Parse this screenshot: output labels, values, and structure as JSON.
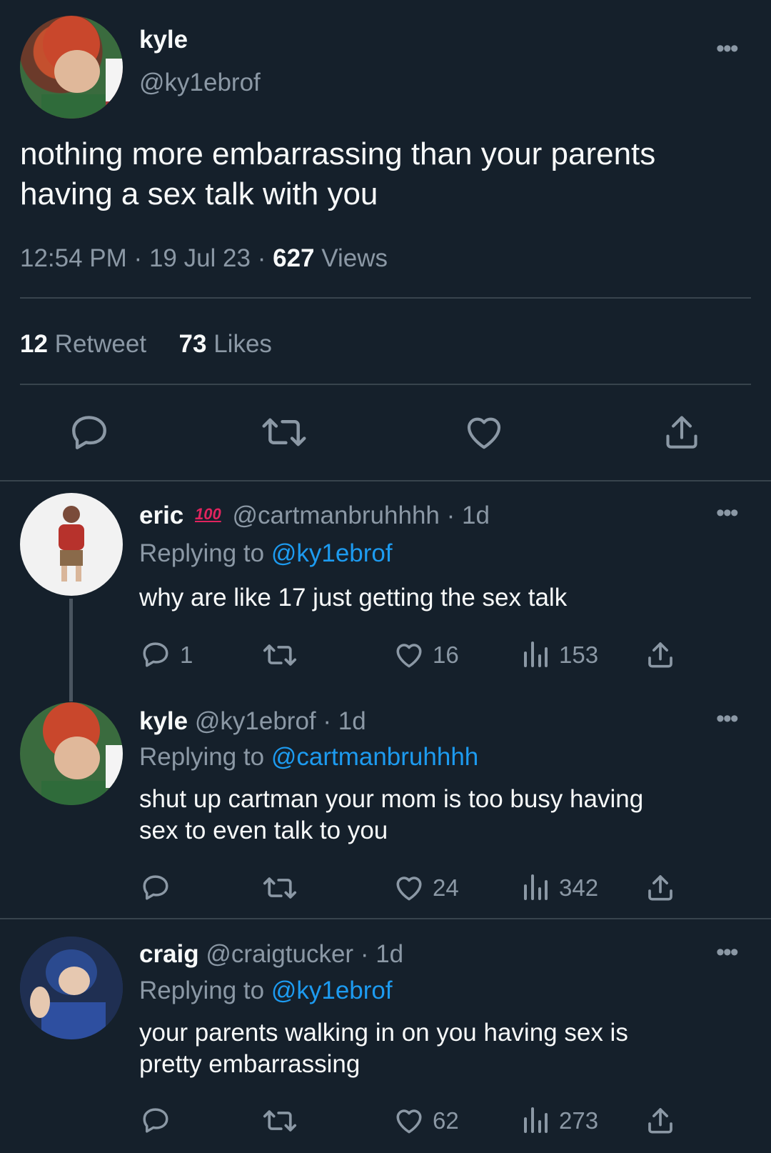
{
  "main_tweet": {
    "name": "kyle",
    "handle": "@ky1ebrof",
    "text_line1": "nothing more embarrassing than your parents",
    "text_line2": "having a sex talk with you",
    "time": "12:54 PM",
    "date": "19 Jul 23",
    "views_count": "627",
    "views_label": "Views",
    "retweet_count": "12",
    "retweet_label": "Retweet",
    "likes_count": "73",
    "likes_label": "Likes"
  },
  "replies": [
    {
      "name": "eric",
      "badge": "100",
      "handle": "@cartmanbruhhhh",
      "age": "1d",
      "replying_label": "Replying to",
      "replying_to": "@ky1ebrof",
      "text_line1": "why are like 17 just getting the sex talk",
      "text_line2": "",
      "reply_count": "1",
      "like_count": "16",
      "view_count": "153"
    },
    {
      "name": "kyle",
      "handle": "@ky1ebrof",
      "age": "1d",
      "replying_label": "Replying to",
      "replying_to": "@cartmanbruhhhh",
      "text_line1": "shut up cartman your mom is too busy having",
      "text_line2": "sex to even talk to you",
      "reply_count": "",
      "like_count": "24",
      "view_count": "342"
    },
    {
      "name": "craig",
      "handle": "@craigtucker",
      "age": "1d",
      "replying_label": "Replying to",
      "replying_to": "@ky1ebrof",
      "text_line1": "your parents walking in on you having sex is",
      "text_line2": "pretty embarrassing",
      "reply_count": "",
      "like_count": "62",
      "view_count": "273"
    }
  ],
  "colors": {
    "background": "#15202b",
    "text": "#f7f9f9",
    "muted": "#8b98a5",
    "link": "#1d9bf0",
    "divider": "#38444d"
  }
}
